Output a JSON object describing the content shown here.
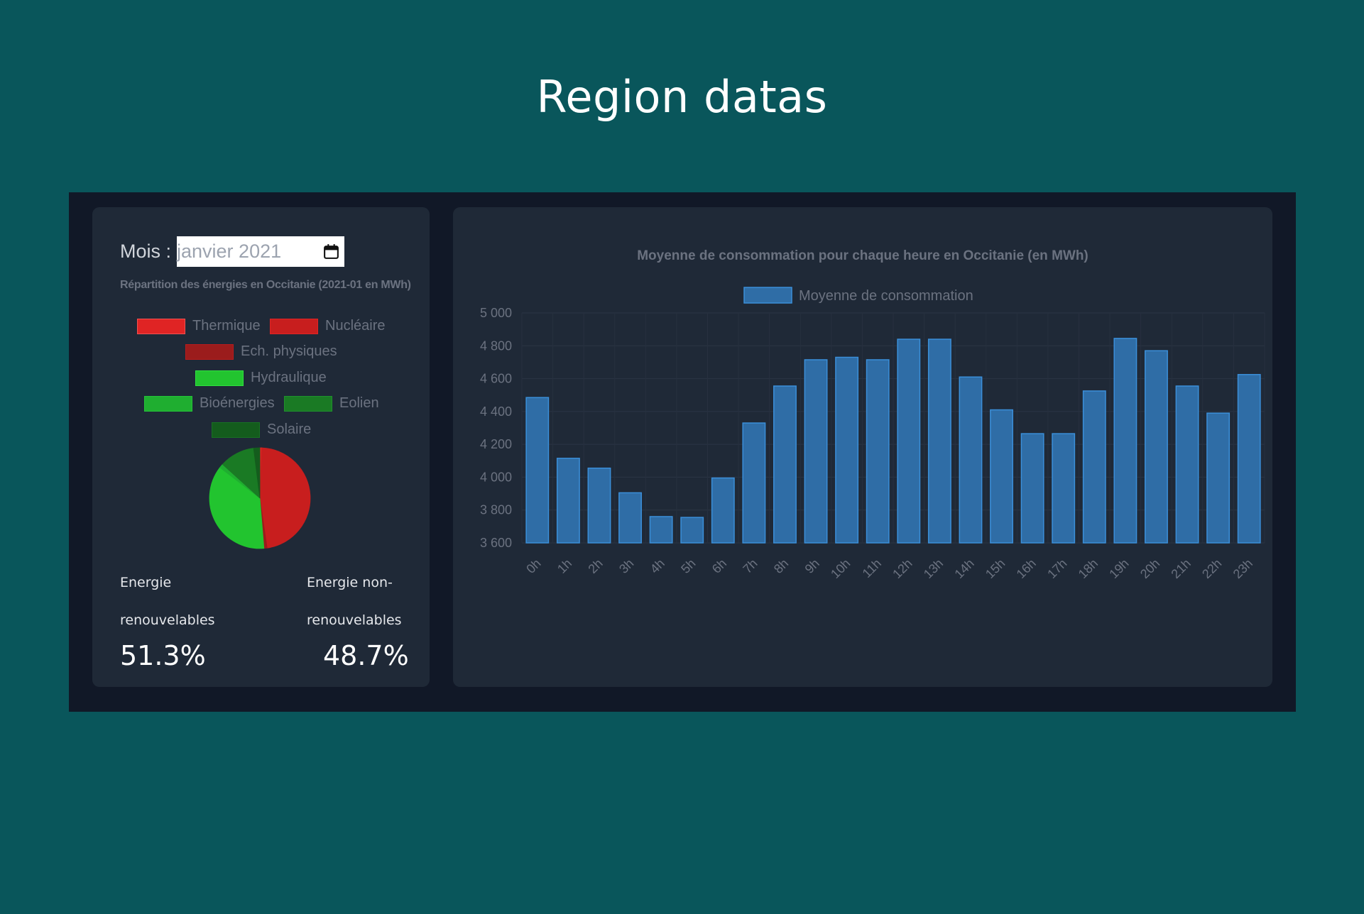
{
  "page": {
    "title": "Region datas"
  },
  "filter": {
    "month_label": "Mois :",
    "month_value": "janvier 2021"
  },
  "pie": {
    "title": "Répartition des énergies en Occitanie (2021-01 en MWh)",
    "legend": [
      {
        "label": "Thermique",
        "color": "#e02424"
      },
      {
        "label": "Nucléaire",
        "color": "#c81e1e"
      },
      {
        "label": "Ech. physiques",
        "color": "#9b1c1c"
      },
      {
        "label": "Hydraulique",
        "color": "#22e03a"
      },
      {
        "label": "Bioénergies",
        "color": "#1fb82f"
      },
      {
        "label": "Eolien",
        "color": "#188a25"
      },
      {
        "label": "Solaire",
        "color": "#145c1d"
      }
    ]
  },
  "stats": {
    "renewable_label_1": "Energie",
    "renewable_label_2": "renouvelables",
    "renewable_value": "51.3%",
    "nonrenewable_label_1": "Energie non-",
    "nonrenewable_label_2": "renouvelables",
    "nonrenewable_value": "48.7%"
  },
  "chart_data": [
    {
      "type": "pie",
      "title": "Répartition des énergies en Occitanie (2021-01 en MWh)",
      "categories": [
        "Thermique",
        "Nucléaire",
        "Ech. physiques",
        "Hydraulique",
        "Bioénergies",
        "Eolien",
        "Solaire"
      ],
      "values": [
        0.6,
        47.1,
        1.0,
        36.7,
        1.3,
        11.3,
        2.0
      ],
      "colors": [
        "#e02424",
        "#c81e1e",
        "#9b1c1c",
        "#22c42f",
        "#1fae30",
        "#1a7a24",
        "#145c1d"
      ],
      "legend": "top"
    },
    {
      "type": "bar",
      "title": "Moyenne de consommation pour chaque heure en Occitanie (en MWh)",
      "categories": [
        "0h",
        "1h",
        "2h",
        "3h",
        "4h",
        "5h",
        "6h",
        "7h",
        "8h",
        "9h",
        "10h",
        "11h",
        "12h",
        "13h",
        "14h",
        "15h",
        "16h",
        "17h",
        "18h",
        "19h",
        "20h",
        "21h",
        "22h",
        "23h"
      ],
      "series": [
        {
          "name": "Moyenne de consommation",
          "values": [
            4485,
            4115,
            4055,
            3905,
            3760,
            3755,
            3995,
            4330,
            4555,
            4715,
            4730,
            4715,
            4840,
            4840,
            4610,
            4410,
            4265,
            4265,
            4525,
            4845,
            4770,
            4555,
            4390,
            4625
          ]
        }
      ],
      "ylim": [
        3600,
        5000
      ],
      "yticks": [
        "5 000",
        "4 800",
        "4 600",
        "4 400",
        "4 200",
        "4 000",
        "3 800",
        "3 600"
      ],
      "ytick_values": [
        5000,
        4800,
        4600,
        4400,
        4200,
        4000,
        3800,
        3600
      ],
      "grid": true,
      "legend": "top",
      "bar_color": "#2f6da6",
      "bar_border": "#3b8fd9"
    }
  ]
}
